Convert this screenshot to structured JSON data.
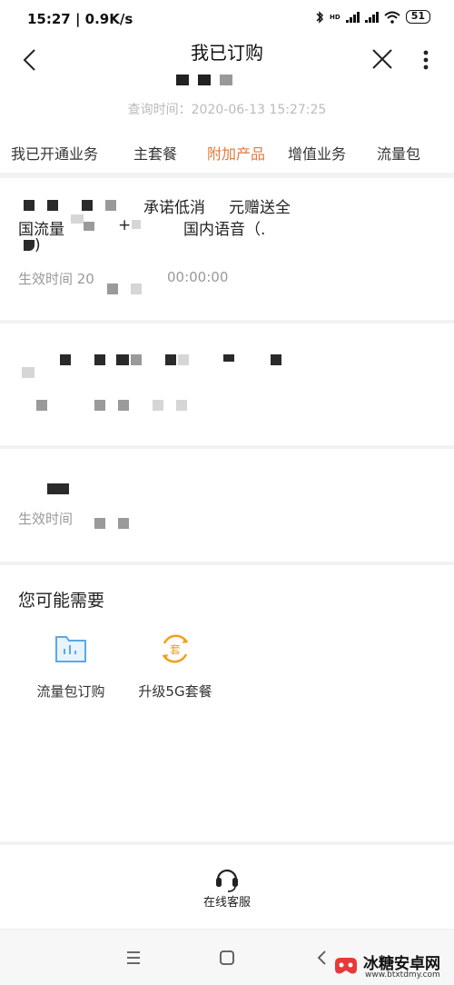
{
  "status_bar": {
    "time": "15:27 | 0.9K/s",
    "battery": "51",
    "hd_label": "HD"
  },
  "header": {
    "title": "我已订购",
    "query_time": "查询时间：2020-06-13 15:27:25"
  },
  "tabs": [
    {
      "label": "我已开通业务",
      "active": false
    },
    {
      "label": "主套餐",
      "active": false
    },
    {
      "label": "附加产品",
      "active": true
    },
    {
      "label": "增值业务",
      "active": false
    },
    {
      "label": "流量包",
      "active": false
    }
  ],
  "products": [
    {
      "name_part1": "承诺低消",
      "name_part2": "元赠送全",
      "name_line2_a": "国流量",
      "name_line2_b": "+",
      "name_line2_c": "国内语音（.",
      "name_line3": ")",
      "effective_label": "生效时间 20",
      "effective_time": "00:00:00"
    },
    {},
    {
      "effective_label": "生效时间"
    }
  ],
  "recommend": {
    "title": "您可能需要",
    "items": [
      {
        "label": "流量包订购",
        "icon": "data-package-icon"
      },
      {
        "label": "升级5G套餐",
        "icon": "upgrade-plan-icon",
        "icon_text": "套"
      }
    ]
  },
  "service": {
    "label": "在线客服",
    "icon": "headset-icon"
  },
  "watermark": {
    "title": "冰糖安卓网",
    "url": "www.btxtdmy.com"
  },
  "colors": {
    "accent": "#e07a3c",
    "icon_blue": "#5aa9e6",
    "icon_orange": "#f0a020"
  }
}
